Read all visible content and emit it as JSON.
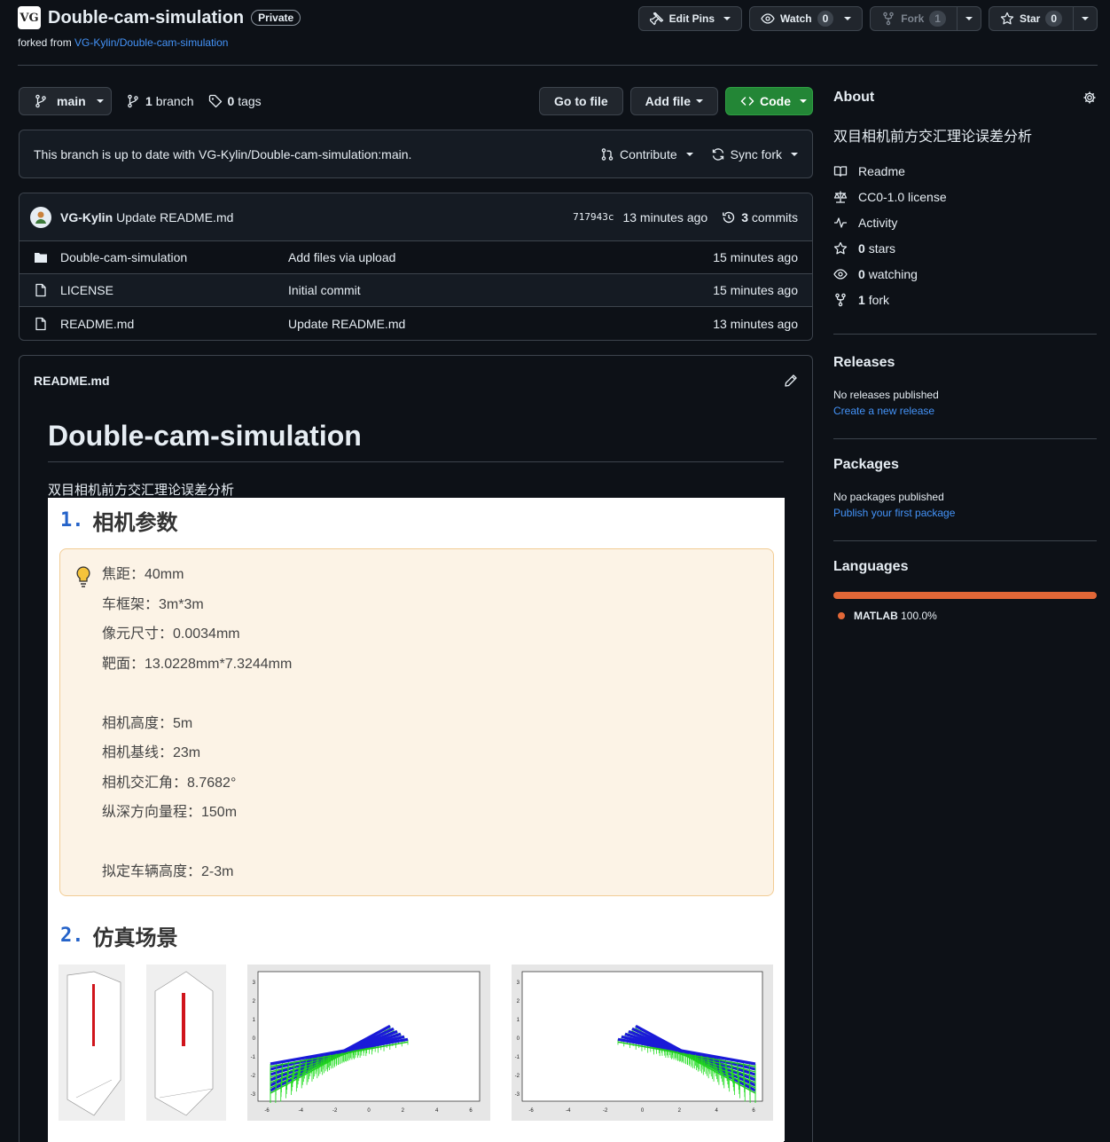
{
  "repo": {
    "name": "Double-cam-simulation",
    "visibility": "Private",
    "forked_prefix": "forked from",
    "forked_from": "VG-Kylin/Double-cam-simulation",
    "logo_text": "VG"
  },
  "header_actions": {
    "edit_pins": "Edit Pins",
    "watch": "Watch",
    "watch_count": "0",
    "fork": "Fork",
    "fork_count": "1",
    "star": "Star",
    "star_count": "0"
  },
  "toolbar": {
    "branch": "main",
    "branches_count": "1",
    "branches_label": "branch",
    "tags_count": "0",
    "tags_label": "tags",
    "go_to_file": "Go to file",
    "add_file": "Add file",
    "code": "Code"
  },
  "sync": {
    "message": "This branch is up to date with VG-Kylin/Double-cam-simulation:main.",
    "contribute": "Contribute",
    "sync_fork": "Sync fork"
  },
  "latest_commit": {
    "author": "VG-Kylin",
    "message": "Update README.md",
    "sha": "717943c",
    "time": "13 minutes ago",
    "commits_count": "3",
    "commits_label": "commits"
  },
  "files": [
    {
      "name": "Double-cam-simulation",
      "type": "folder",
      "message": "Add files via upload",
      "time": "15 minutes ago"
    },
    {
      "name": "LICENSE",
      "type": "file",
      "message": "Initial commit",
      "time": "15 minutes ago"
    },
    {
      "name": "README.md",
      "type": "file",
      "message": "Update README.md",
      "time": "13 minutes ago"
    }
  ],
  "readme": {
    "file_label": "README.md",
    "h1": "Double-cam-simulation",
    "description": "双目相机前方交汇理论误差分析",
    "section1": {
      "num": "1.",
      "title": "相机参数"
    },
    "params": [
      "焦距：40mm",
      "车框架：3m*3m",
      "像元尺寸：0.0034mm",
      "靶面：13.0228mm*7.3244mm",
      "",
      "相机高度：5m",
      "相机基线：23m",
      "相机交汇角：8.7682°",
      "纵深方向量程：150m",
      "",
      "拟定车辆高度：2-3m"
    ],
    "section2": {
      "num": "2.",
      "title": "仿真场景"
    },
    "plot_ticks_x": [
      "-6",
      "-4",
      "-2",
      "0",
      "2",
      "4",
      "6"
    ],
    "plot_ticks_y": [
      "3",
      "2",
      "1",
      "0",
      "-1",
      "-2",
      "-3"
    ]
  },
  "sidebar": {
    "about_title": "About",
    "about_desc": "双目相机前方交汇理论误差分析",
    "about_items": [
      {
        "icon": "book-icon",
        "label": "Readme",
        "bold": ""
      },
      {
        "icon": "law-icon",
        "label": "CC0-1.0 license",
        "bold": ""
      },
      {
        "icon": "pulse-icon",
        "label": "Activity",
        "bold": ""
      },
      {
        "icon": "star-icon",
        "label": "stars",
        "bold": "0"
      },
      {
        "icon": "eye-icon",
        "label": "watching",
        "bold": "0"
      },
      {
        "icon": "fork-icon",
        "label": "fork",
        "bold": "1"
      }
    ],
    "releases_title": "Releases",
    "releases_empty": "No releases published",
    "releases_link": "Create a new release",
    "packages_title": "Packages",
    "packages_empty": "No packages published",
    "packages_link": "Publish your first package",
    "languages_title": "Languages",
    "languages": [
      {
        "name": "MATLAB",
        "percent": "100.0%",
        "color": "#e16737"
      }
    ]
  },
  "colors": {
    "accent": "#4493f8",
    "green": "#238636",
    "matlab": "#e16737"
  }
}
